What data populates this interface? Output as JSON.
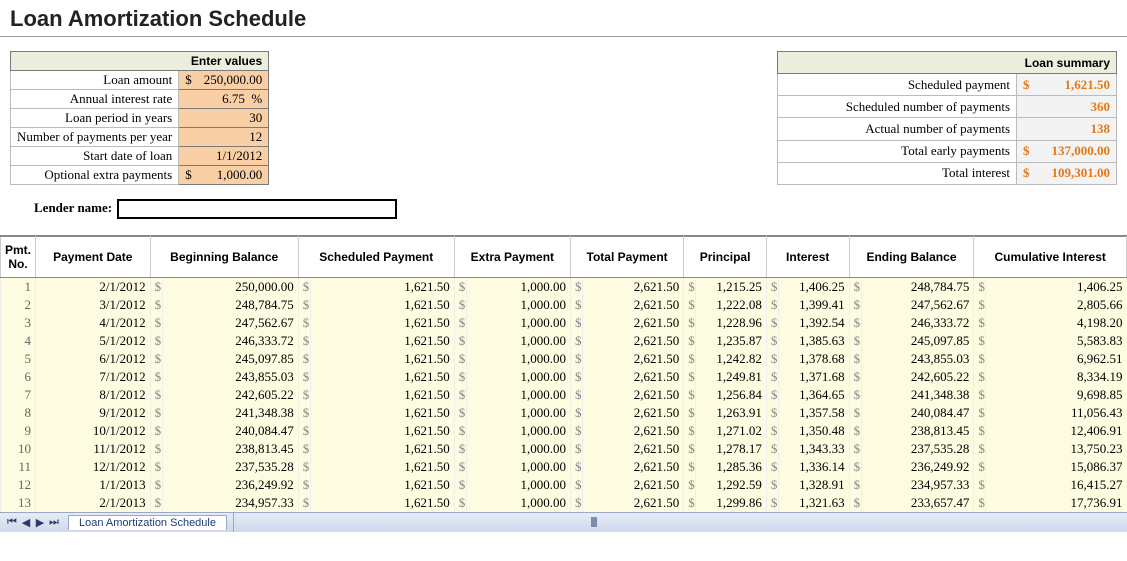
{
  "title": "Loan Amortization Schedule",
  "inputs_header": "Enter values",
  "inputs": {
    "loan_amount_label": "Loan amount",
    "loan_amount_value": "250,000.00",
    "annual_rate_label": "Annual interest rate",
    "annual_rate_value": "6.75",
    "loan_period_label": "Loan period in years",
    "loan_period_value": "30",
    "payments_per_year_label": "Number of payments per year",
    "payments_per_year_value": "12",
    "start_date_label": "Start date of loan",
    "start_date_value": "1/1/2012",
    "extra_payments_label": "Optional extra payments",
    "extra_payments_value": "1,000.00"
  },
  "summary_header": "Loan summary",
  "summary": {
    "scheduled_payment_label": "Scheduled payment",
    "scheduled_payment_value": "1,621.50",
    "scheduled_num_label": "Scheduled number of payments",
    "scheduled_num_value": "360",
    "actual_num_label": "Actual number of payments",
    "actual_num_value": "138",
    "total_early_label": "Total early payments",
    "total_early_value": "137,000.00",
    "total_interest_label": "Total interest",
    "total_interest_value": "109,301.00"
  },
  "lender_label": "Lender name:",
  "lender_value": "",
  "columns": {
    "pmt_no": "Pmt. No.",
    "payment_date": "Payment Date",
    "beginning_balance": "Beginning Balance",
    "scheduled_payment": "Scheduled Payment",
    "extra_payment": "Extra Payment",
    "total_payment": "Total Payment",
    "principal": "Principal",
    "interest": "Interest",
    "ending_balance": "Ending Balance",
    "cumulative_interest": "Cumulative Interest"
  },
  "rows": [
    {
      "no": "1",
      "date": "2/1/2012",
      "begin": "250,000.00",
      "sched": "1,621.50",
      "extra": "1,000.00",
      "total": "2,621.50",
      "principal": "1,215.25",
      "interest": "1,406.25",
      "end": "248,784.75",
      "cum": "1,406.25"
    },
    {
      "no": "2",
      "date": "3/1/2012",
      "begin": "248,784.75",
      "sched": "1,621.50",
      "extra": "1,000.00",
      "total": "2,621.50",
      "principal": "1,222.08",
      "interest": "1,399.41",
      "end": "247,562.67",
      "cum": "2,805.66"
    },
    {
      "no": "3",
      "date": "4/1/2012",
      "begin": "247,562.67",
      "sched": "1,621.50",
      "extra": "1,000.00",
      "total": "2,621.50",
      "principal": "1,228.96",
      "interest": "1,392.54",
      "end": "246,333.72",
      "cum": "4,198.20"
    },
    {
      "no": "4",
      "date": "5/1/2012",
      "begin": "246,333.72",
      "sched": "1,621.50",
      "extra": "1,000.00",
      "total": "2,621.50",
      "principal": "1,235.87",
      "interest": "1,385.63",
      "end": "245,097.85",
      "cum": "5,583.83"
    },
    {
      "no": "5",
      "date": "6/1/2012",
      "begin": "245,097.85",
      "sched": "1,621.50",
      "extra": "1,000.00",
      "total": "2,621.50",
      "principal": "1,242.82",
      "interest": "1,378.68",
      "end": "243,855.03",
      "cum": "6,962.51"
    },
    {
      "no": "6",
      "date": "7/1/2012",
      "begin": "243,855.03",
      "sched": "1,621.50",
      "extra": "1,000.00",
      "total": "2,621.50",
      "principal": "1,249.81",
      "interest": "1,371.68",
      "end": "242,605.22",
      "cum": "8,334.19"
    },
    {
      "no": "7",
      "date": "8/1/2012",
      "begin": "242,605.22",
      "sched": "1,621.50",
      "extra": "1,000.00",
      "total": "2,621.50",
      "principal": "1,256.84",
      "interest": "1,364.65",
      "end": "241,348.38",
      "cum": "9,698.85"
    },
    {
      "no": "8",
      "date": "9/1/2012",
      "begin": "241,348.38",
      "sched": "1,621.50",
      "extra": "1,000.00",
      "total": "2,621.50",
      "principal": "1,263.91",
      "interest": "1,357.58",
      "end": "240,084.47",
      "cum": "11,056.43"
    },
    {
      "no": "9",
      "date": "10/1/2012",
      "begin": "240,084.47",
      "sched": "1,621.50",
      "extra": "1,000.00",
      "total": "2,621.50",
      "principal": "1,271.02",
      "interest": "1,350.48",
      "end": "238,813.45",
      "cum": "12,406.91"
    },
    {
      "no": "10",
      "date": "11/1/2012",
      "begin": "238,813.45",
      "sched": "1,621.50",
      "extra": "1,000.00",
      "total": "2,621.50",
      "principal": "1,278.17",
      "interest": "1,343.33",
      "end": "237,535.28",
      "cum": "13,750.23"
    },
    {
      "no": "11",
      "date": "12/1/2012",
      "begin": "237,535.28",
      "sched": "1,621.50",
      "extra": "1,000.00",
      "total": "2,621.50",
      "principal": "1,285.36",
      "interest": "1,336.14",
      "end": "236,249.92",
      "cum": "15,086.37"
    },
    {
      "no": "12",
      "date": "1/1/2013",
      "begin": "236,249.92",
      "sched": "1,621.50",
      "extra": "1,000.00",
      "total": "2,621.50",
      "principal": "1,292.59",
      "interest": "1,328.91",
      "end": "234,957.33",
      "cum": "16,415.27"
    },
    {
      "no": "13",
      "date": "2/1/2013",
      "begin": "234,957.33",
      "sched": "1,621.50",
      "extra": "1,000.00",
      "total": "2,621.50",
      "principal": "1,299.86",
      "interest": "1,321.63",
      "end": "233,657.47",
      "cum": "17,736.91"
    }
  ],
  "sheet_tab": "Loan Amortization Schedule",
  "currency": "$",
  "percent": "%"
}
